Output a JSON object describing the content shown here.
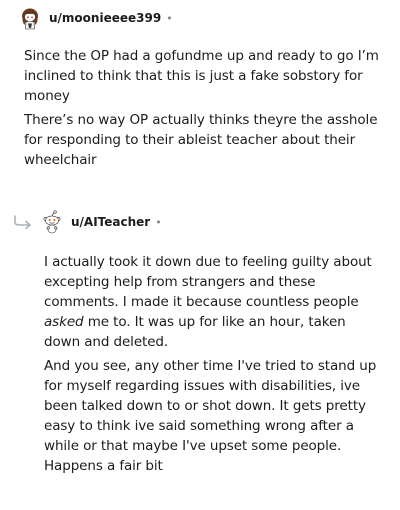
{
  "comments": [
    {
      "username": "u/moonieeee399",
      "separator": "•",
      "avatar": "snoo-avatar-brown-hair-icon",
      "paragraphs": [
        "Since the OP had a gofundme up and ready to go I’m inclined to think that this is just a fake sobstory for money",
        "There’s no way OP actually thinks theyre the asshole for responding to their ableist teacher about their wheelchair"
      ]
    },
    {
      "username": "u/AITeacher",
      "separator": "•",
      "avatar": "snoo-avatar-default-icon",
      "reply_icon": "reply-arrow-icon",
      "paragraph1": {
        "before": "I actually took it down due to feeling guilty about excepting help from strangers and these comments. I made it because countless people ",
        "emphasis": "asked",
        "after": " me to. It was up for like an hour, taken down and deleted."
      },
      "paragraph2": "And you see, any other time I've tried to stand up for myself regarding issues with disabilities, ive been talked down to or shot down. It gets pretty easy to think ive said something wrong after a while or that maybe I've upset some people. Happens a fair bit"
    }
  ],
  "colors": {
    "text": "#1c1c1c",
    "meta": "#878a8c",
    "reply_arrow": "#a8b0ba"
  }
}
